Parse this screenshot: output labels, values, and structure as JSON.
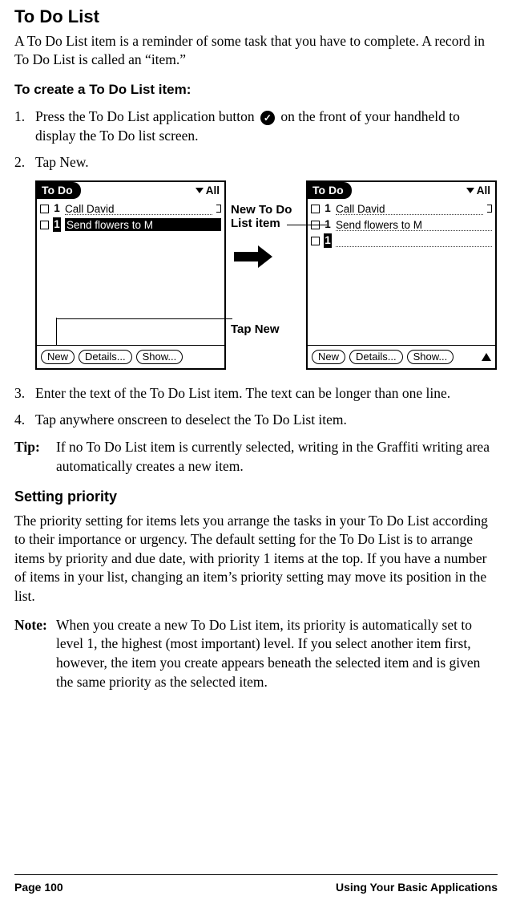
{
  "title": "To Do List",
  "intro": "A To Do List item is a reminder of some task that you have to complete. A record in To Do List is called an “item.”",
  "create_heading": "To create a To Do List item:",
  "steps": {
    "s1_num": "1.",
    "s1a": "Press the To Do List application button ",
    "s1b": " on the front of your handheld to display the To Do list screen.",
    "s2_num": "2.",
    "s2": "Tap New.",
    "s3_num": "3.",
    "s3": "Enter the text of the To Do List item. The text can be longer than one line.",
    "s4_num": "4.",
    "s4": "Tap anywhere onscreen to deselect the To Do List item."
  },
  "figure": {
    "todo_title": "To Do",
    "all_label": "All",
    "item1_pri": "1",
    "item1_text": "Call David",
    "item2_pri": "1",
    "item2_text": "Send flowers to M",
    "btn_new": "New",
    "btn_details": "Details...",
    "btn_show": "Show...",
    "label_newitem": "New To Do List item",
    "label_tapnew": "Tap New"
  },
  "tip_label": "Tip:",
  "tip_text": "If no To Do List item is currently selected, writing in the Graffiti writing area automatically creates a new item.",
  "priority_heading": "Setting priority",
  "priority_para": "The priority setting for items lets you arrange the tasks in your To Do List according to their importance or urgency. The default setting for the To Do List is to arrange items by priority and due date, with priority 1 items at the top. If you have a number of items in your list, changing an item’s priority setting may move its position in the list.",
  "note_label": "Note:",
  "note_text": "When you create a new To Do List item, its priority is automatically set to level 1, the highest (most important) level. If you select another item first, however, the item you create appears beneath the selected item and is given the same priority as the selected item.",
  "footer_left": "Page 100",
  "footer_right": "Using Your Basic Applications"
}
